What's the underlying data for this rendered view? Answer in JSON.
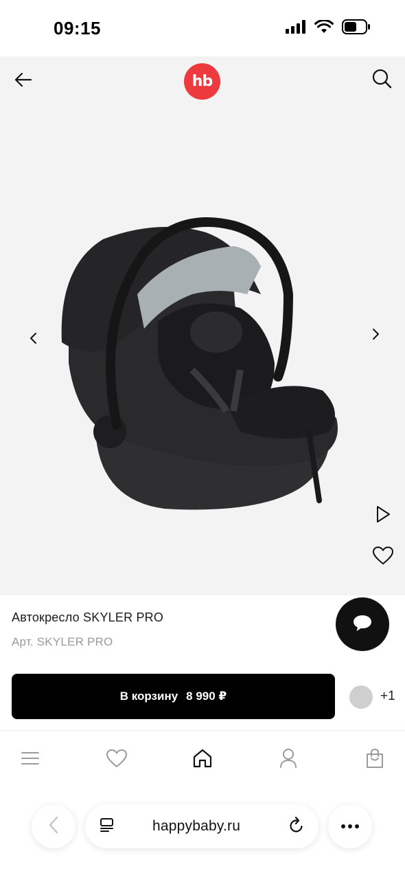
{
  "status_bar": {
    "time": "09:15",
    "icons": [
      "signal-icon",
      "wifi-icon",
      "battery-icon"
    ]
  },
  "header": {
    "logo_text": "hb",
    "logo_color": "#ec3a3f",
    "icons": [
      "back-arrow-icon",
      "search-icon"
    ]
  },
  "gallery": {
    "icons": [
      "chevron-left-icon",
      "chevron-right-icon",
      "play-icon",
      "heart-icon"
    ]
  },
  "product": {
    "title": "Автокресло SKYLER PRO",
    "sku": "Арт. SKYLER PRO",
    "cart_label": "В корзину",
    "price": "8 990 ₽",
    "color_swatch": "#cfcfcf",
    "more_colors": "+1"
  },
  "bottom_nav": {
    "items": [
      "menu-icon",
      "favorites-icon",
      "home-icon",
      "profile-icon",
      "cart-icon"
    ]
  },
  "browser": {
    "domain": "happybaby.ru",
    "icons": [
      "back-icon",
      "reader-icon",
      "reload-icon",
      "more-icon"
    ]
  }
}
